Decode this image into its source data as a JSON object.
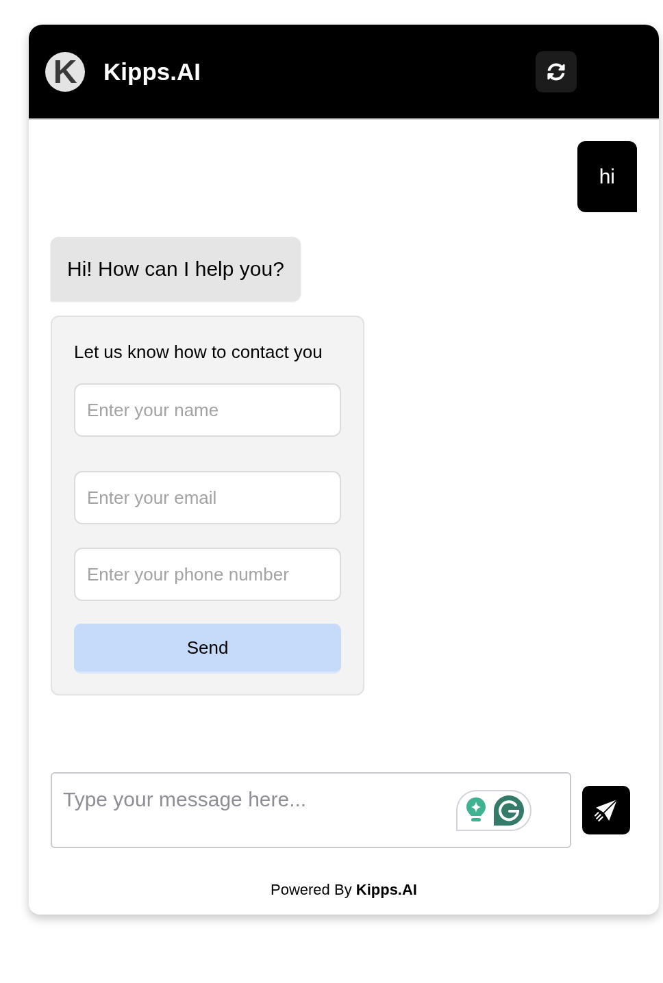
{
  "header": {
    "logo_text": "K",
    "title": "Kipps.AI"
  },
  "messages": [
    {
      "kind": "user",
      "text": "hi"
    },
    {
      "kind": "bot",
      "text": "Hi! How can I help you?"
    },
    {
      "kind": "form",
      "title": "Let us know how to contact you",
      "fields": [
        {
          "placeholder": "Enter your name"
        },
        {
          "placeholder": "Enter your email"
        },
        {
          "placeholder": "Enter your phone number"
        }
      ],
      "button": "Send"
    }
  ],
  "composer": {
    "placeholder": "Type your message here..."
  },
  "footer": "Powered By **Kipps.AI**"
}
